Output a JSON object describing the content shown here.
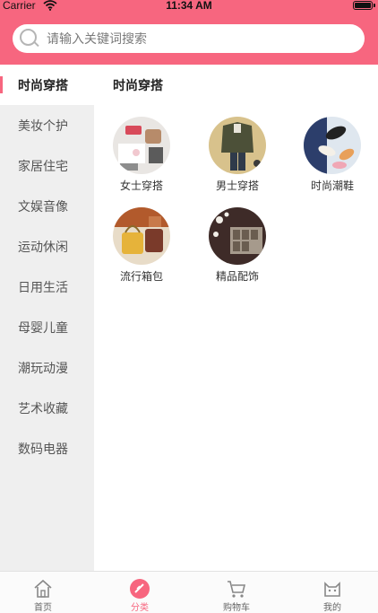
{
  "status_bar": {
    "carrier": "Carrier",
    "time": "11:34 AM"
  },
  "search": {
    "placeholder": "请输入关键词搜索"
  },
  "sidebar": {
    "items": [
      {
        "label": "时尚穿搭",
        "active": true
      },
      {
        "label": "美妆个护"
      },
      {
        "label": "家居住宅"
      },
      {
        "label": "文娱音像"
      },
      {
        "label": "运动休闲"
      },
      {
        "label": "日用生活"
      },
      {
        "label": "母婴儿童"
      },
      {
        "label": "潮玩动漫"
      },
      {
        "label": "艺术收藏"
      },
      {
        "label": "数码电器"
      }
    ]
  },
  "main": {
    "title": "时尚穿搭",
    "items": [
      {
        "label": "女士穿搭",
        "icon": "womens-clothing-photo"
      },
      {
        "label": "男士穿搭",
        "icon": "mens-clothing-photo"
      },
      {
        "label": "时尚潮鞋",
        "icon": "fashion-shoes-photo"
      },
      {
        "label": "流行箱包",
        "icon": "bags-photo"
      },
      {
        "label": "精品配饰",
        "icon": "accessories-photo"
      }
    ]
  },
  "tabbar": {
    "tabs": [
      {
        "label": "首页",
        "icon": "home-icon"
      },
      {
        "label": "分类",
        "icon": "category-icon",
        "active": true
      },
      {
        "label": "购物车",
        "icon": "cart-icon"
      },
      {
        "label": "我的",
        "icon": "profile-icon"
      }
    ]
  },
  "colors": {
    "accent": "#f7667f",
    "sidebar_bg": "#efefef"
  }
}
